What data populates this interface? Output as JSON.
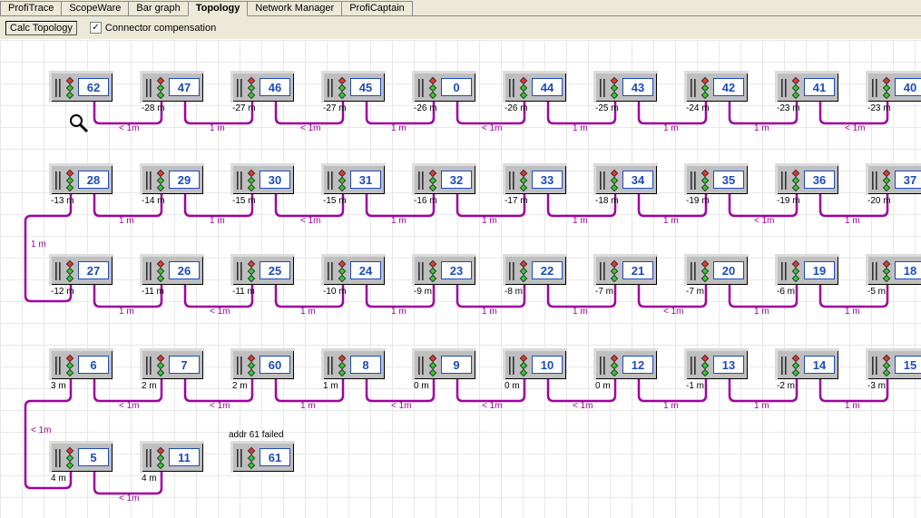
{
  "tabs": [
    "ProfiTrace",
    "ScopeWare",
    "Bar graph",
    "Topology",
    "Network Manager",
    "ProfiCaptain"
  ],
  "active_tab": 3,
  "toolbar": {
    "calc_label": "Calc Topology",
    "chk_label": "Connector compensation",
    "chk_checked": true
  },
  "layout": {
    "row_y": [
      36,
      138,
      238,
      342,
      444
    ],
    "col_x": [
      56,
      156,
      256,
      356,
      456,
      556,
      656,
      756,
      856,
      956
    ]
  },
  "nodes": [
    {
      "row": 0,
      "col": 0,
      "addr": "62",
      "dist": ""
    },
    {
      "row": 0,
      "col": 1,
      "addr": "47",
      "dist": "-28 m"
    },
    {
      "row": 0,
      "col": 2,
      "addr": "46",
      "dist": "-27 m"
    },
    {
      "row": 0,
      "col": 3,
      "addr": "45",
      "dist": "-27 m"
    },
    {
      "row": 0,
      "col": 4,
      "addr": "0",
      "dist": "-26 m"
    },
    {
      "row": 0,
      "col": 5,
      "addr": "44",
      "dist": "-26 m"
    },
    {
      "row": 0,
      "col": 6,
      "addr": "43",
      "dist": "-25 m"
    },
    {
      "row": 0,
      "col": 7,
      "addr": "42",
      "dist": "-24 m"
    },
    {
      "row": 0,
      "col": 8,
      "addr": "41",
      "dist": "-23 m"
    },
    {
      "row": 0,
      "col": 9,
      "addr": "40",
      "dist": "-23 m"
    },
    {
      "row": 1,
      "col": 0,
      "addr": "28",
      "dist": "-13 m"
    },
    {
      "row": 1,
      "col": 1,
      "addr": "29",
      "dist": "-14 m"
    },
    {
      "row": 1,
      "col": 2,
      "addr": "30",
      "dist": "-15 m"
    },
    {
      "row": 1,
      "col": 3,
      "addr": "31",
      "dist": "-15 m"
    },
    {
      "row": 1,
      "col": 4,
      "addr": "32",
      "dist": "-16 m"
    },
    {
      "row": 1,
      "col": 5,
      "addr": "33",
      "dist": "-17 m"
    },
    {
      "row": 1,
      "col": 6,
      "addr": "34",
      "dist": "-18 m"
    },
    {
      "row": 1,
      "col": 7,
      "addr": "35",
      "dist": "-19 m"
    },
    {
      "row": 1,
      "col": 8,
      "addr": "36",
      "dist": "-19 m"
    },
    {
      "row": 1,
      "col": 9,
      "addr": "37",
      "dist": "-20 m"
    },
    {
      "row": 2,
      "col": 0,
      "addr": "27",
      "dist": "-12 m"
    },
    {
      "row": 2,
      "col": 1,
      "addr": "26",
      "dist": "-11 m"
    },
    {
      "row": 2,
      "col": 2,
      "addr": "25",
      "dist": "-11 m"
    },
    {
      "row": 2,
      "col": 3,
      "addr": "24",
      "dist": "-10 m"
    },
    {
      "row": 2,
      "col": 4,
      "addr": "23",
      "dist": "-9 m"
    },
    {
      "row": 2,
      "col": 5,
      "addr": "22",
      "dist": "-8 m"
    },
    {
      "row": 2,
      "col": 6,
      "addr": "21",
      "dist": "-7 m"
    },
    {
      "row": 2,
      "col": 7,
      "addr": "20",
      "dist": "-7 m"
    },
    {
      "row": 2,
      "col": 8,
      "addr": "19",
      "dist": "-6 m"
    },
    {
      "row": 2,
      "col": 9,
      "addr": "18",
      "dist": "-5 m"
    },
    {
      "row": 3,
      "col": 0,
      "addr": "6",
      "dist": "3 m"
    },
    {
      "row": 3,
      "col": 1,
      "addr": "7",
      "dist": "2 m"
    },
    {
      "row": 3,
      "col": 2,
      "addr": "60",
      "dist": "2 m"
    },
    {
      "row": 3,
      "col": 3,
      "addr": "8",
      "dist": "1 m"
    },
    {
      "row": 3,
      "col": 4,
      "addr": "9",
      "dist": "0 m"
    },
    {
      "row": 3,
      "col": 5,
      "addr": "10",
      "dist": "0 m"
    },
    {
      "row": 3,
      "col": 6,
      "addr": "12",
      "dist": "0 m"
    },
    {
      "row": 3,
      "col": 7,
      "addr": "13",
      "dist": "-1 m"
    },
    {
      "row": 3,
      "col": 8,
      "addr": "14",
      "dist": "-2 m"
    },
    {
      "row": 3,
      "col": 9,
      "addr": "15",
      "dist": "-3 m"
    },
    {
      "row": 4,
      "col": 0,
      "addr": "5",
      "dist": "4 m"
    },
    {
      "row": 4,
      "col": 1,
      "addr": "11",
      "dist": "4 m"
    },
    {
      "row": 4,
      "col": 2,
      "addr": "61",
      "dist": ""
    }
  ],
  "seg_labels": {
    "r0": [
      "< 1m",
      "1 m",
      "< 1m",
      "1 m",
      "< 1m",
      "1 m",
      "1 m",
      "1 m",
      "< 1m"
    ],
    "r1": [
      "1 m",
      "1 m",
      "< 1m",
      "1 m",
      "1 m",
      "1 m",
      "1 m",
      "< 1m",
      "1 m"
    ],
    "r2": [
      "1 m",
      "< 1m",
      "1 m",
      "1 m",
      "1 m",
      "1 m",
      "< 1m",
      "1 m",
      "1 m"
    ],
    "r3": [
      "< 1m",
      "< 1m",
      "1 m",
      "< 1m",
      "< 1m",
      "< 1m",
      "1 m",
      "1 m",
      "1 m"
    ],
    "r4": [
      "< 1m"
    ],
    "edge12": "1 m",
    "edge34": "< 1m"
  },
  "annotations": {
    "failed": "addr 61 failed"
  }
}
